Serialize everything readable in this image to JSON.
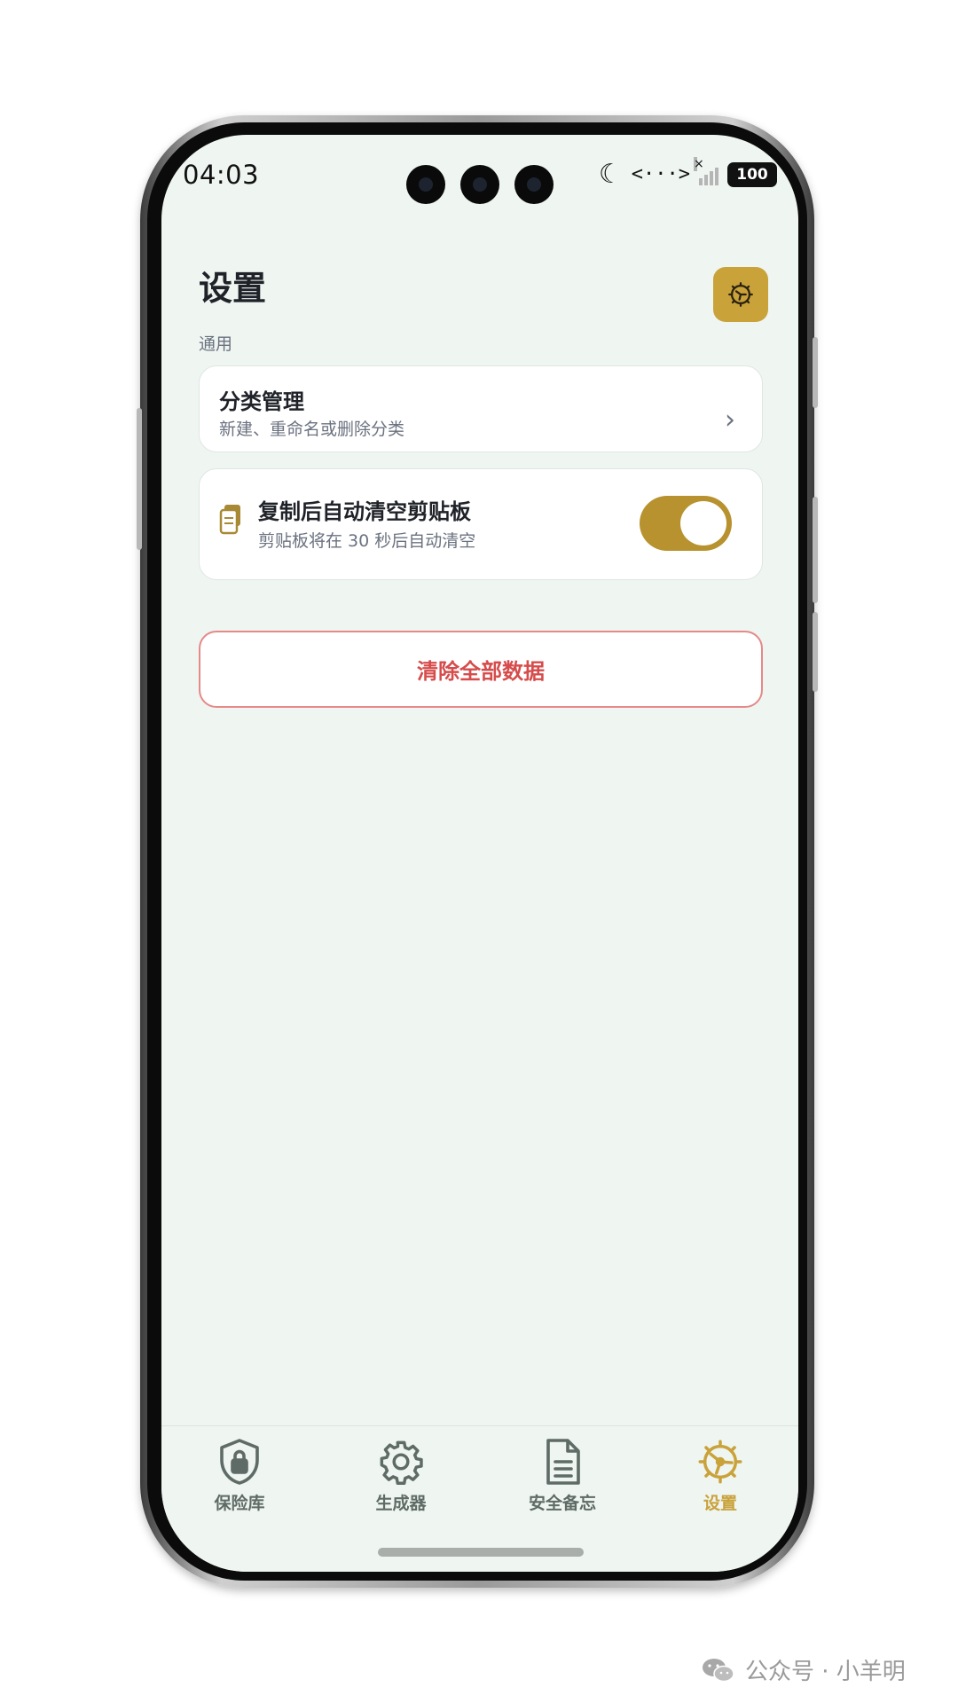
{
  "status_bar": {
    "time": "04:03",
    "battery": "100",
    "network_glyph": "<···>"
  },
  "header": {
    "title": "设置",
    "section_label": "通用"
  },
  "cards": {
    "category": {
      "title": "分类管理",
      "subtitle": "新建、重命名或删除分类"
    },
    "clipboard": {
      "title": "复制后自动清空剪贴板",
      "subtitle": "剪贴板将在 30 秒后自动清空",
      "enabled": true
    }
  },
  "danger_button": {
    "label": "清除全部数据"
  },
  "bottom_nav": {
    "items": [
      {
        "label": "保险库",
        "icon": "shield-lock-icon",
        "active": false
      },
      {
        "label": "生成器",
        "icon": "gear-icon",
        "active": false
      },
      {
        "label": "安全备忘",
        "icon": "document-icon",
        "active": false
      },
      {
        "label": "设置",
        "icon": "settings-wheel-icon",
        "active": true
      }
    ]
  },
  "watermark": {
    "text": "公众号 · 小羊明"
  },
  "colors": {
    "accent": "#c9a23a",
    "danger": "#d64b4b",
    "background": "#eff5f1"
  }
}
